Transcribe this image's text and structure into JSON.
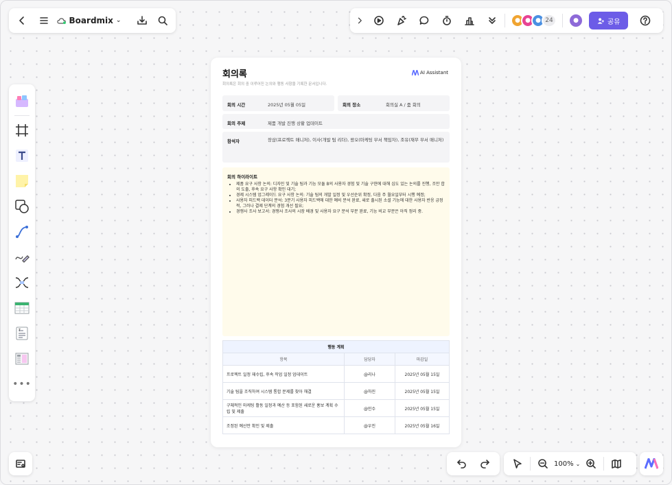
{
  "toolbar_left": {
    "app_name": "Boardmix"
  },
  "toolbar_right": {
    "avatar_count": "24",
    "share_label": "공유"
  },
  "zoom": {
    "level": "100%"
  },
  "document": {
    "title": "회의록",
    "subtitle": "회의록은 회의 중 이루어진 논의와 행동 사항을 기록한 문서입니다.",
    "ai_badge": "AI Assistant",
    "info": {
      "time_label": "회의 시간",
      "time_value": "2025년 05월 05일",
      "place_label": "회의 장소",
      "place_value": "회의실 A / 줌 회의",
      "topic_label": "회의 주제",
      "topic_value": "제품 개발 진행 상황 업데이트",
      "attendees_label": "참석자",
      "attendees_value": "장삼(프로젝트 매니저), 이사(개발 팀 리더), 왕오(마케팅 부서 책임자), 조유(재무 부서 매니저)"
    },
    "highlights": {
      "title": "회의 하이라이트",
      "items": [
        "제품 요구 사항 논의: 디자인 및 기술 팀과 기능 모듈 B의 사용자 경험 및 기술 구현에 대해 심도 있는 논의를 진행, 조만 합의 도출, 후속 요구 사항 확인 대기;",
        "경제 시스템 업그레이드 요구 사항 논의: 기술 팀의 개발 일정 및 우선순위 확정, 다음 주 월요일부터 시행 예정;",
        "사용자 피드백 데이터 분석: 3분기 사용자 피드백에 대한 예비 분석 완료, 새로 출시된 소셜 기능에 대한 사용자 반응 긍정적, 그러나 결제 단계의 경험 개선 필요;",
        "경쟁사 조사 보고서: 경쟁사 조사의 시장 배경 및 사용자 요구 분석 부분 완료, 기능 비교 부분은 아직 정리 중."
      ]
    },
    "action_plan": {
      "caption": "행동 계획",
      "headers": [
        "항목",
        "담당자",
        "마감일"
      ],
      "rows": [
        [
          "프로젝트 일정 재수립, 후속 작업 일정 업데이트",
          "@리나",
          "2025년 05월 15일"
        ],
        [
          "기술 팀을 조직하여 시스템 통합 문제를 찾아 해결",
          "@하진",
          "2025년 05월 15일"
        ],
        [
          "구체적인 마케팅 활동 일정과 예산 등 포함된 새로운 홍보 계획 수립 및 제출",
          "@민수",
          "2025년 05월 15일"
        ],
        [
          "조정된 예산안 확인 및 제출",
          "@우진",
          "2025년 05월 16일"
        ]
      ]
    }
  },
  "icons": {
    "top_left": [
      "back-icon",
      "menu-icon",
      "cloud-icon",
      "download-icon",
      "search-icon"
    ],
    "top_right": [
      "chevron-right-icon",
      "play-icon",
      "celebrate-icon",
      "comment-icon",
      "timer-icon",
      "vote-icon",
      "more-chevrons-icon",
      "help-icon"
    ],
    "vertical": [
      "templates-icon",
      "frame-icon",
      "text-icon",
      "sticky-note-icon",
      "shape-icon",
      "connector-icon",
      "pen-icon",
      "mindmap-icon",
      "table-icon",
      "document-icon",
      "layout-icon",
      "more-icon"
    ]
  },
  "colors": {
    "accent": "#6c5ce7",
    "highlight_bg": "#fffbeb",
    "table_header": "#eef3ff"
  }
}
